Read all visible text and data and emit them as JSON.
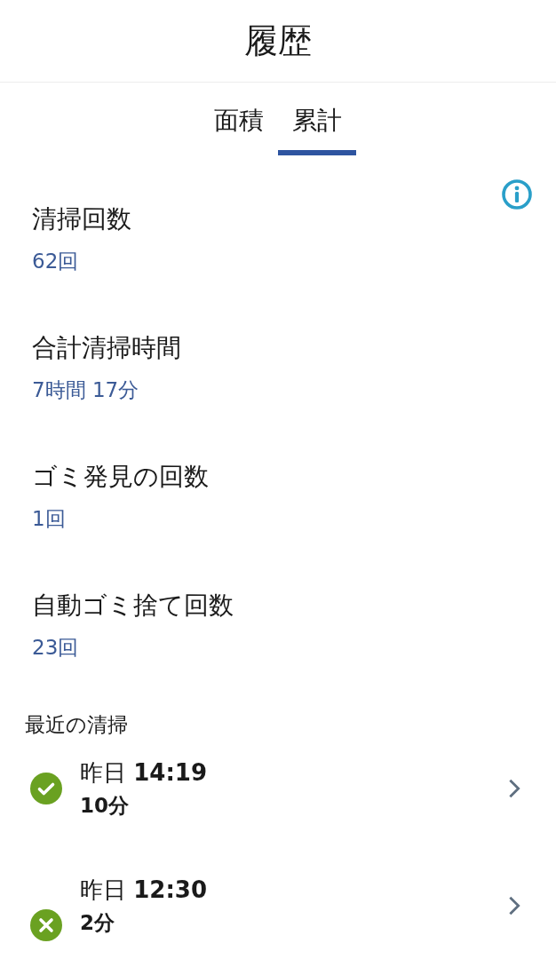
{
  "header": {
    "title": "履歴"
  },
  "tabs": [
    {
      "label": "面積",
      "selected": false
    },
    {
      "label": "累計",
      "selected": true
    }
  ],
  "stats": [
    {
      "label": "清掃回数",
      "value": "62回"
    },
    {
      "label": "合計清掃時間",
      "value": "7時間 17分"
    },
    {
      "label": "ゴミ発見の回数",
      "value": "1回"
    },
    {
      "label": "自動ゴミ捨て回数",
      "value": "23回"
    }
  ],
  "recent": {
    "heading": "最近の清掃",
    "items": [
      {
        "day": "昨日",
        "time": "14:19",
        "duration": "10分",
        "completed": true
      },
      {
        "day": "昨日",
        "time": "12:30",
        "duration": "2分",
        "completed": false
      }
    ]
  }
}
